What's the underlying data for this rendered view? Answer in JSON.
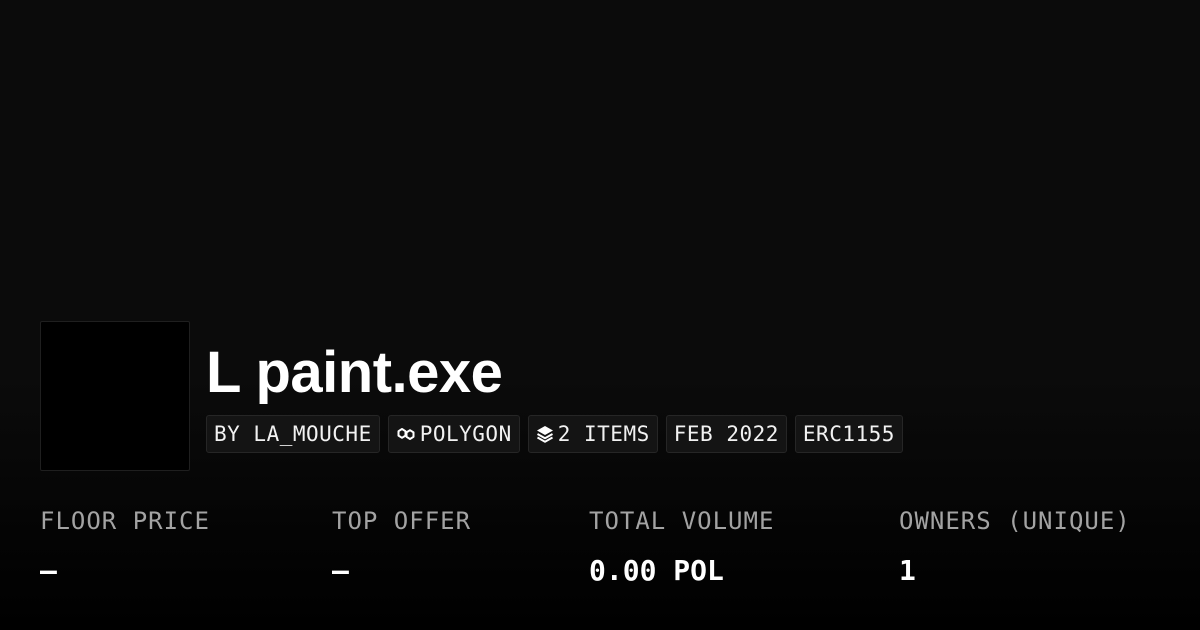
{
  "collection": {
    "title": "L paint.exe"
  },
  "tags": {
    "creator": "BY LA_MOUCHE",
    "chain": "POLYGON",
    "chain_icon": "polygon-chain-icon",
    "items": "2 ITEMS",
    "items_icon": "layers-icon",
    "date": "FEB 2022",
    "standard": "ERC1155"
  },
  "stats": {
    "floor_price": {
      "label": "FLOOR PRICE",
      "value": "–"
    },
    "top_offer": {
      "label": "TOP OFFER",
      "value": "–"
    },
    "total_volume": {
      "label": "TOTAL VOLUME",
      "value": "0.00 POL"
    },
    "owners": {
      "label": "OWNERS (UNIQUE)",
      "value": "1"
    }
  },
  "colors": {
    "background": "#0b0b0b",
    "text": "#ffffff",
    "label": "#a3a3a3",
    "tag_background": "#141414"
  }
}
